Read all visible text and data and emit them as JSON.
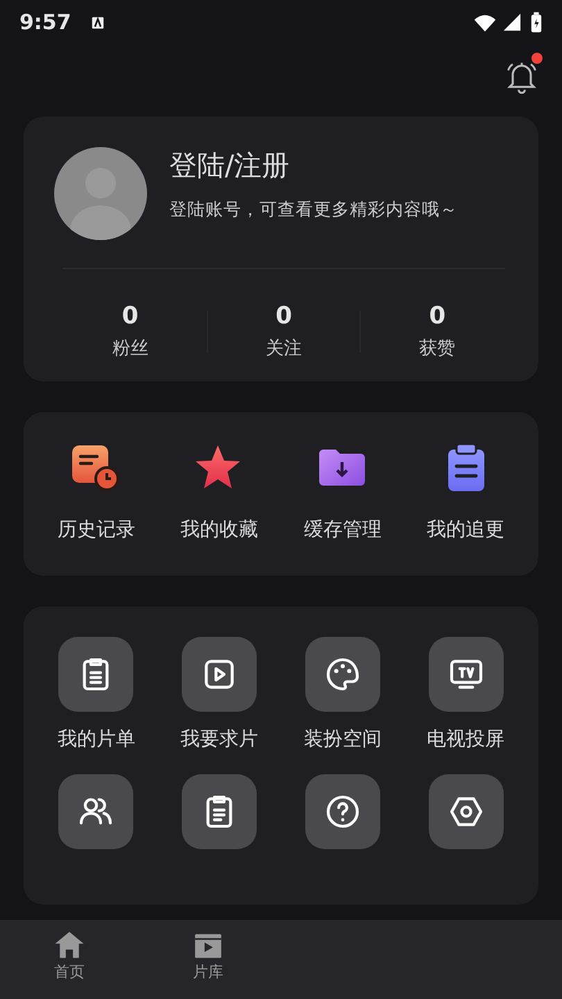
{
  "status_bar": {
    "time": "9:57"
  },
  "header": {
    "notification_dot": true
  },
  "profile": {
    "title": "登陆/注册",
    "subtitle": "登陆账号，可查看更多精彩内容哦～",
    "stats": [
      {
        "value": "0",
        "label": "粉丝"
      },
      {
        "value": "0",
        "label": "关注"
      },
      {
        "value": "0",
        "label": "获赞"
      }
    ]
  },
  "shortcuts": [
    {
      "kind": "history",
      "label": "历史记录"
    },
    {
      "kind": "favorite",
      "label": "我的收藏"
    },
    {
      "kind": "download",
      "label": "缓存管理"
    },
    {
      "kind": "follow",
      "label": "我的追更"
    }
  ],
  "tools": [
    {
      "kind": "list",
      "label": "我的片单"
    },
    {
      "kind": "play",
      "label": "我要求片"
    },
    {
      "kind": "palette",
      "label": "装扮空间"
    },
    {
      "kind": "tv",
      "label": "电视投屏"
    },
    {
      "kind": "users"
    },
    {
      "kind": "clipboard"
    },
    {
      "kind": "help"
    },
    {
      "kind": "settings"
    }
  ],
  "bottom_nav": [
    {
      "kind": "home",
      "label": "首页"
    },
    {
      "kind": "library",
      "label": "片库"
    }
  ]
}
